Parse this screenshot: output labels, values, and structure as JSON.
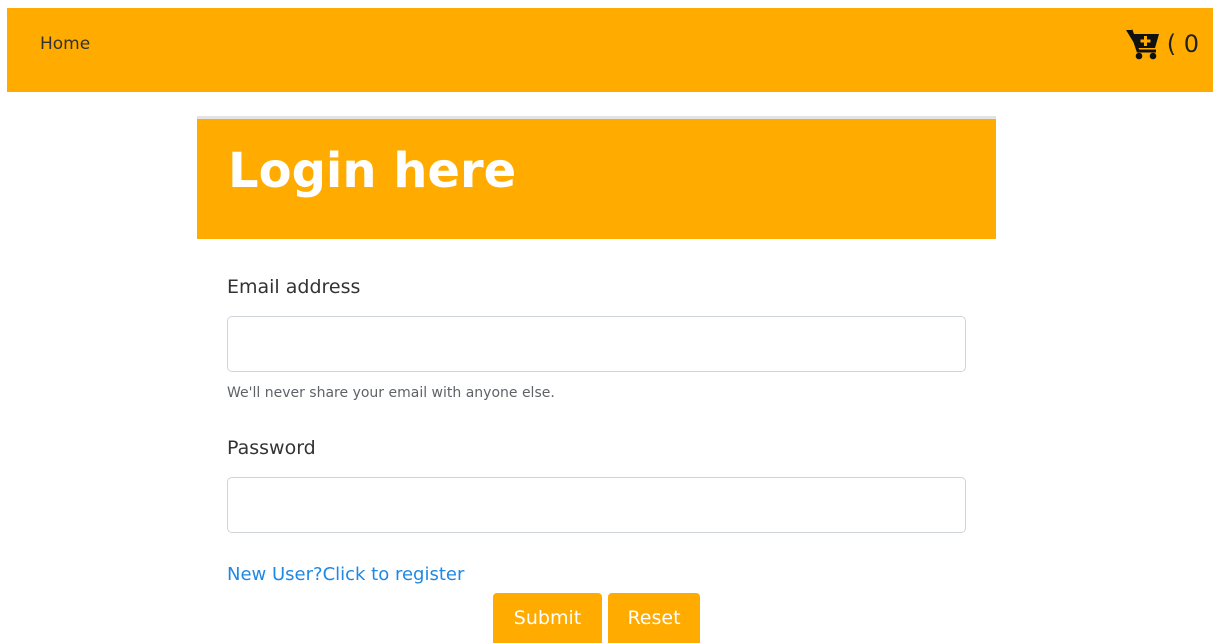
{
  "navbar": {
    "home_label": "Home",
    "cart_icon": "cart-plus-icon",
    "cart_count": "( 0"
  },
  "login": {
    "title": "Login here",
    "email_label": "Email address",
    "email_value": "",
    "email_help": "We'll never share your email with anyone else.",
    "password_label": "Password",
    "password_value": "",
    "register_link": "New User?Click to register",
    "submit_label": "Submit",
    "reset_label": "Reset"
  },
  "colors": {
    "accent": "#ffab00",
    "link": "#1e88e5"
  }
}
